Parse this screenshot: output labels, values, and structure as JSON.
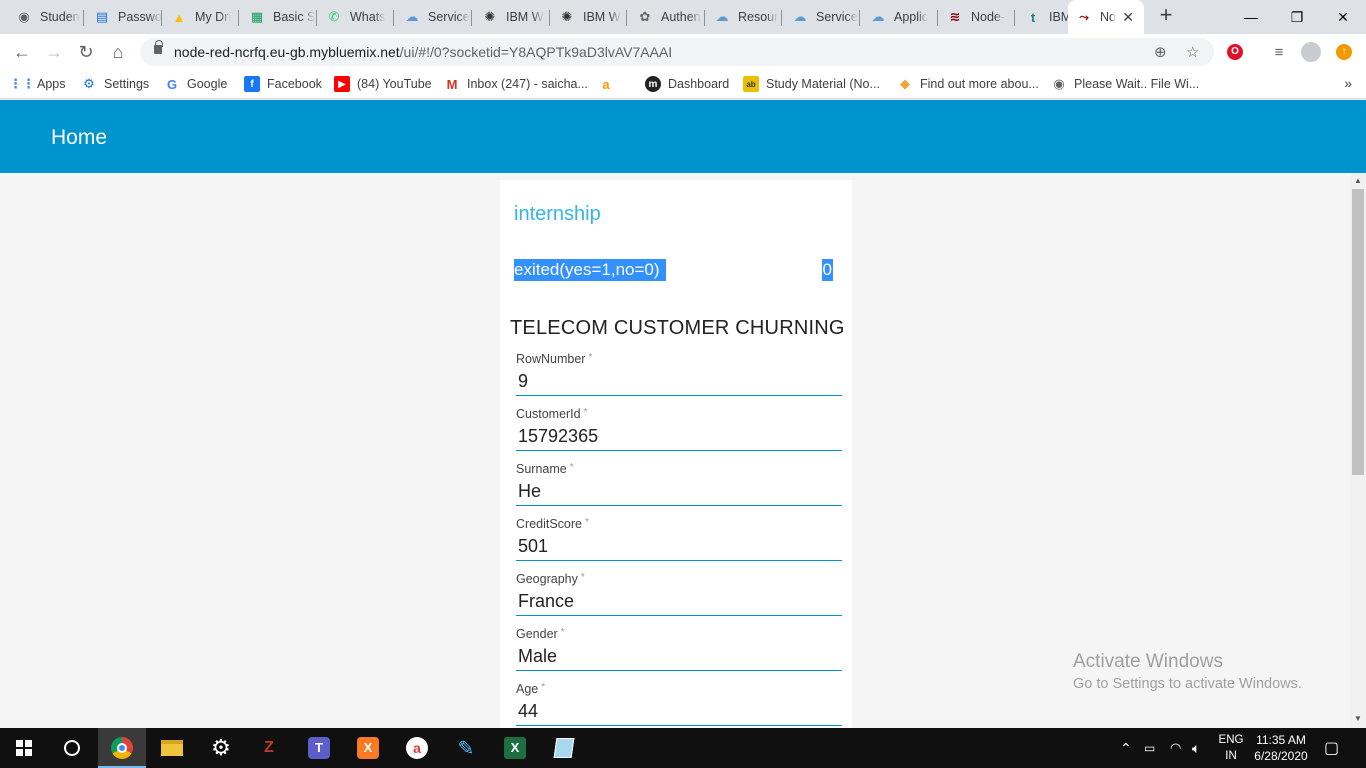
{
  "browser": {
    "tabs": [
      {
        "title": "Studen",
        "icon": "globe-icon",
        "color": "#5f6368"
      },
      {
        "title": "Passwo",
        "icon": "chart-icon",
        "color": "#1a73e8"
      },
      {
        "title": "My Dri",
        "icon": "drive-icon",
        "color": "#fbbc04"
      },
      {
        "title": "Basic S",
        "icon": "sheets-icon",
        "color": "#0f9d58"
      },
      {
        "title": "Whats",
        "icon": "whatsapp-icon",
        "color": "#25d366"
      },
      {
        "title": "Service",
        "icon": "cloud-icon",
        "color": "#5b9bd5"
      },
      {
        "title": "IBM W",
        "icon": "watson-icon",
        "color": "#333333"
      },
      {
        "title": "IBM W",
        "icon": "watson-icon",
        "color": "#333333"
      },
      {
        "title": "Authen",
        "icon": "settings-icon",
        "color": "#666666"
      },
      {
        "title": "Resour",
        "icon": "cloud-icon",
        "color": "#5b9bd5"
      },
      {
        "title": "Service",
        "icon": "cloud-icon",
        "color": "#5b9bd5"
      },
      {
        "title": "Applic",
        "icon": "cloud-icon",
        "color": "#5b9bd5"
      },
      {
        "title": "Node-",
        "icon": "nodered-icon",
        "color": "#8f0000"
      },
      {
        "title": "IBM A",
        "icon": "ibm-t-icon",
        "color": "#12857e"
      }
    ],
    "active_tab": {
      "title": "No",
      "icon": "nodered-flow-icon"
    },
    "url_host": "node-red-ncrfq.eu-gb.mybluemix.net",
    "url_path": "/ui/#!/0?socketid=Y8AQPTk9aD3lvAV7AAAI",
    "bookmarks": [
      {
        "label": "Apps",
        "icon": "apps-grid-icon",
        "color": "#4285f4"
      },
      {
        "label": "Settings",
        "icon": "gear-icon",
        "color": "#1a73e8"
      },
      {
        "label": "Google",
        "icon": "google-icon",
        "color": "#4285f4"
      },
      {
        "label": "Facebook",
        "icon": "facebook-icon",
        "color": "#1877f2"
      },
      {
        "label": "(84) YouTube",
        "icon": "youtube-icon",
        "color": "#ff0000"
      },
      {
        "label": "Inbox (247) - saicha...",
        "icon": "gmail-icon",
        "color": "#d93025"
      },
      {
        "label": "",
        "icon": "amazon-icon",
        "color": "#ff9900"
      },
      {
        "label": "Dashboard",
        "icon": "dashboard-icon",
        "color": "#333333"
      },
      {
        "label": "Study Material (No...",
        "icon": "study-icon",
        "color": "#e8c000"
      },
      {
        "label": "Find out more abou...",
        "icon": "diamond-icon",
        "color": "#f2a33a"
      },
      {
        "label": "Please Wait.. File Wi...",
        "icon": "globe-icon",
        "color": "#5f6368"
      }
    ]
  },
  "dashboard": {
    "header_title": "Home",
    "group_title": "internship",
    "text_label": "exited(yes=1,no=0)",
    "text_value": "0",
    "form_title": "TELECOM CUSTOMER CHURNING",
    "fields": [
      {
        "label": "RowNumber",
        "value": "9"
      },
      {
        "label": "CustomerId",
        "value": "15792365"
      },
      {
        "label": "Surname",
        "value": "He"
      },
      {
        "label": "CreditScore",
        "value": "501"
      },
      {
        "label": "Geography",
        "value": "France"
      },
      {
        "label": "Gender",
        "value": "Male"
      },
      {
        "label": "Age",
        "value": "44"
      }
    ],
    "required_mark": "*"
  },
  "watermark": {
    "line1": "Activate Windows",
    "line2": "Go to Settings to activate Windows."
  },
  "taskbar": {
    "lang_top": "ENG",
    "lang_bottom": "IN",
    "time": "11:35 AM",
    "date": "6/28/2020"
  }
}
